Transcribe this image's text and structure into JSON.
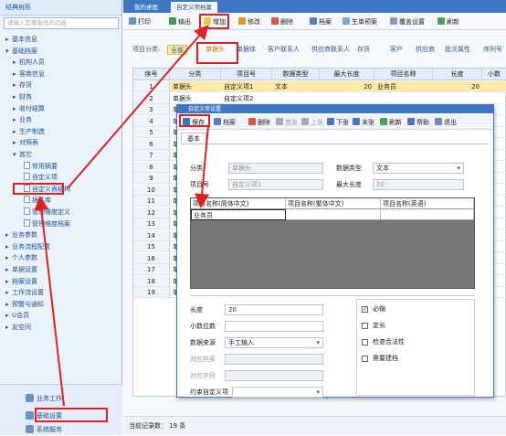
{
  "sidebar": {
    "title": "经典树形",
    "search_placeholder": "请输入您要查找的功能",
    "tree": [
      {
        "label": "基本信息",
        "arrow": "▸"
      },
      {
        "label": "基础档案",
        "arrow": "▾"
      },
      {
        "label": "机构人员",
        "arrow": "▸"
      },
      {
        "label": "客商信息",
        "arrow": "▸"
      },
      {
        "label": "存货",
        "arrow": "▸"
      },
      {
        "label": "财务",
        "arrow": "▸"
      },
      {
        "label": "收付结算",
        "arrow": "▸"
      },
      {
        "label": "业务",
        "arrow": "▸"
      },
      {
        "label": "生产制造",
        "arrow": "▸"
      },
      {
        "label": "对照表",
        "arrow": "▸"
      },
      {
        "label": "其它",
        "arrow": "▾"
      },
      {
        "label": "常用摘要",
        "arrow": ""
      },
      {
        "label": "自定义项",
        "arrow": ""
      },
      {
        "label": "自定义表结构",
        "arrow": ""
      },
      {
        "label": "插件库",
        "arrow": ""
      },
      {
        "label": "管理维度定义",
        "arrow": ""
      },
      {
        "label": "管理维度档案",
        "arrow": ""
      },
      {
        "label": "业务参数",
        "arrow": "▸"
      },
      {
        "label": "业务流程配置",
        "arrow": "▸"
      },
      {
        "label": "个人参数",
        "arrow": "▸"
      },
      {
        "label": "单据设置",
        "arrow": "▸"
      },
      {
        "label": "档案设置",
        "arrow": "▸"
      },
      {
        "label": "工作流设置",
        "arrow": "▸"
      },
      {
        "label": "预警与通知",
        "arrow": "▸"
      },
      {
        "label": "U会员",
        "arrow": "▸"
      },
      {
        "label": "友空间",
        "arrow": "▸"
      }
    ],
    "bottom": {
      "work": "业务工作",
      "settings": "基础设置",
      "service": "系统服务"
    }
  },
  "tabs": {
    "t1": "我的桌面",
    "t2": "自定义项档案"
  },
  "toolbar": {
    "print": "打印",
    "output": "输出",
    "add": "增加",
    "edit": "修改",
    "delete": "删除",
    "archive": "档案",
    "generate": "生单预案",
    "page_setup": "覆盖设置",
    "refresh": "刷新"
  },
  "categories": {
    "label": "项目分类:",
    "items": [
      "全部",
      "单据头",
      "单据体",
      "客户联系人",
      "供应商联系人",
      "存货",
      "客户",
      "供应商",
      "批次属性",
      "序列号"
    ]
  },
  "grid": {
    "headers": [
      "序号",
      "分类",
      "项目号",
      "数据类型",
      "最大长度",
      "项目名称",
      "长度",
      "小数"
    ],
    "rows": [
      {
        "no": "1",
        "cat": "单据头",
        "item": "自定义项1",
        "type": "文本",
        "maxlen": "20",
        "name": "业务员",
        "len": "20"
      },
      {
        "no": "2",
        "cat": "单据头",
        "item": "自定义项2",
        "type": "",
        "maxlen": "",
        "name": "",
        "len": ""
      },
      {
        "no": "3",
        "cat": "单",
        "item": "",
        "type": "",
        "maxlen": "",
        "name": "",
        "len": ""
      },
      {
        "no": "4",
        "cat": "单",
        "item": "",
        "type": "",
        "maxlen": "",
        "name": "",
        "len": ""
      },
      {
        "no": "5",
        "cat": "单",
        "item": "",
        "type": "",
        "maxlen": "",
        "name": "",
        "len": ""
      },
      {
        "no": "6",
        "cat": "单",
        "item": "",
        "type": "",
        "maxlen": "",
        "name": "",
        "len": ""
      },
      {
        "no": "7",
        "cat": "单",
        "item": "",
        "type": "",
        "maxlen": "",
        "name": "",
        "len": ""
      },
      {
        "no": "8",
        "cat": "单",
        "item": "",
        "type": "",
        "maxlen": "",
        "name": "",
        "len": ""
      },
      {
        "no": "9",
        "cat": "单",
        "item": "",
        "type": "",
        "maxlen": "",
        "name": "",
        "len": ""
      },
      {
        "no": "10",
        "cat": "单",
        "item": "",
        "type": "",
        "maxlen": "",
        "name": "",
        "len": ""
      },
      {
        "no": "11",
        "cat": "单",
        "item": "",
        "type": "",
        "maxlen": "",
        "name": "",
        "len": ""
      },
      {
        "no": "12",
        "cat": "单",
        "item": "",
        "type": "",
        "maxlen": "",
        "name": "",
        "len": ""
      },
      {
        "no": "13",
        "cat": "单",
        "item": "",
        "type": "",
        "maxlen": "",
        "name": "",
        "len": ""
      },
      {
        "no": "14",
        "cat": "单",
        "item": "",
        "type": "",
        "maxlen": "",
        "name": "",
        "len": ""
      },
      {
        "no": "15",
        "cat": "单",
        "item": "",
        "type": "",
        "maxlen": "",
        "name": "",
        "len": ""
      },
      {
        "no": "16",
        "cat": "单",
        "item": "",
        "type": "",
        "maxlen": "",
        "name": "",
        "len": ""
      },
      {
        "no": "17",
        "cat": "单",
        "item": "",
        "type": "",
        "maxlen": "",
        "name": "",
        "len": ""
      },
      {
        "no": "18",
        "cat": "单",
        "item": "",
        "type": "",
        "maxlen": "",
        "name": "",
        "len": ""
      },
      {
        "no": "19",
        "cat": "单",
        "item": "",
        "type": "",
        "maxlen": "",
        "name": "",
        "len": ""
      }
    ]
  },
  "status": {
    "record_count": "当前记录数： 19 条"
  },
  "dialog": {
    "title": "自定义项设置",
    "toolbar": {
      "save": "保存",
      "archive": "档案",
      "delete": "删除",
      "first": "首张",
      "prev": "上张",
      "next": "下张",
      "last": "末张",
      "refresh": "刷新",
      "help": "帮助",
      "exit": "退出"
    },
    "tab": "基本",
    "fields": {
      "category_label": "分类",
      "category_value": "单据头",
      "datatype_label": "数据类型",
      "datatype_value": "文本",
      "item_label": "项目号",
      "item_value": "自定义项1",
      "maxlen_label": "最大长度",
      "maxlen_value": "20"
    },
    "multilang": {
      "headers": [
        "项目名称(简体中文)",
        "项目名称(繁体中文)",
        "项目名称(英语)"
      ],
      "value": "业务员"
    },
    "bottom": {
      "length_label": "长度",
      "length_value": "20",
      "decimals_label": "小数位数",
      "source_label": "数据来源",
      "source_value": "手工输入",
      "archive_label": "对应档案",
      "field_label": "对应字段",
      "constraint_label": "约束自定义项"
    },
    "checks": [
      {
        "label": "必输",
        "checked": true
      },
      {
        "label": "定长",
        "checked": false
      },
      {
        "label": "检查合法性",
        "checked": false
      },
      {
        "label": "需要建档",
        "checked": false
      }
    ]
  },
  "colors": {
    "accent": "#3e78c3",
    "highlight": "#e02020",
    "selected_row": "#ffe9a6"
  }
}
